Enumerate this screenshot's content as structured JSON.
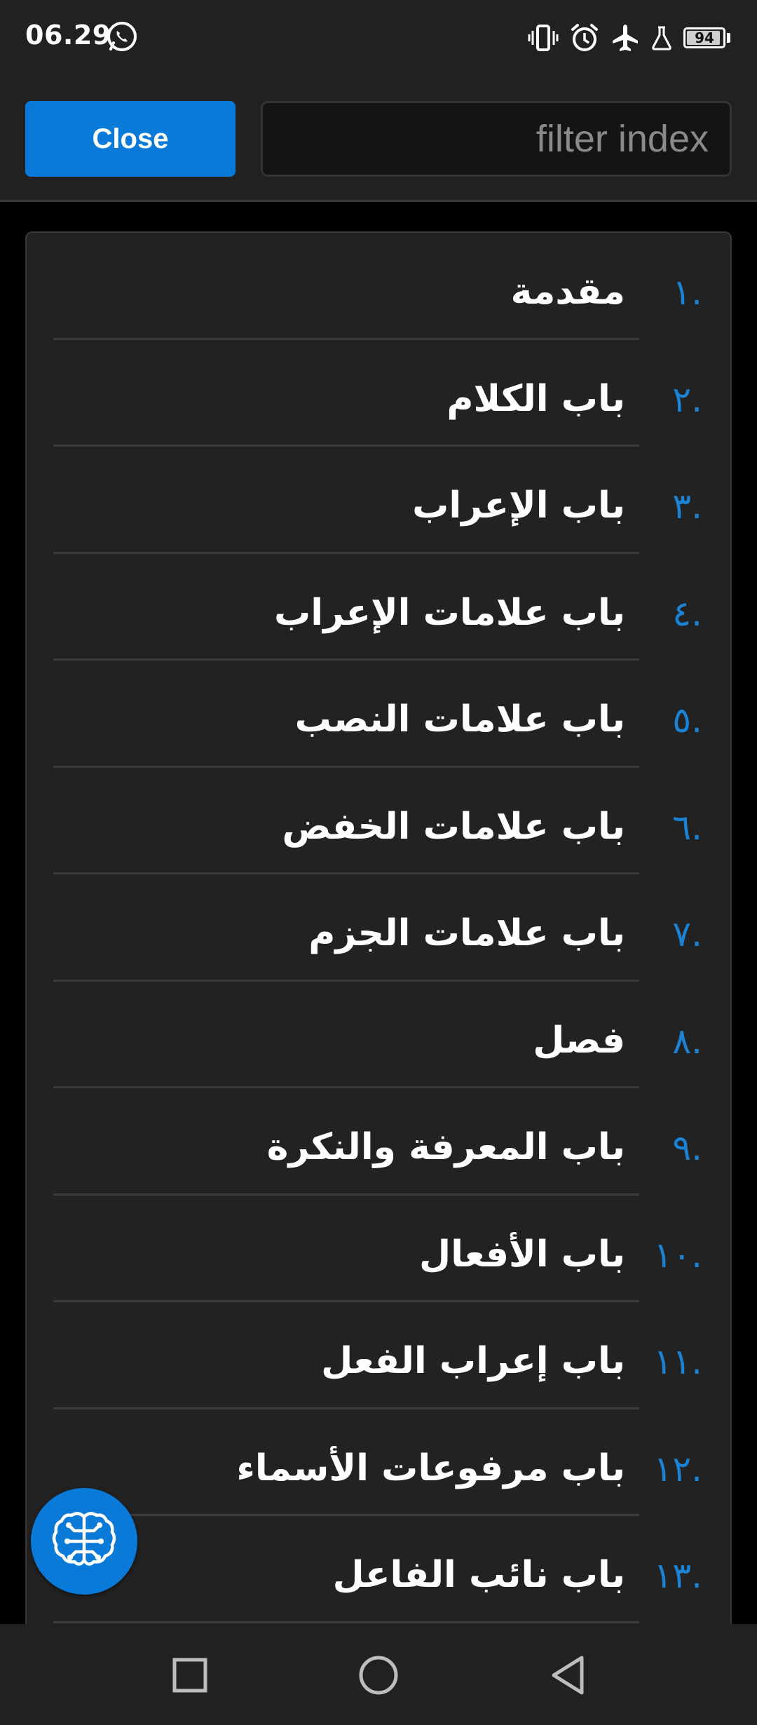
{
  "status_bar": {
    "time": "06.29",
    "battery_level": 94,
    "icons": [
      "whatsapp-icon",
      "vibrate-icon",
      "alarm-icon",
      "airplane-icon",
      "lab-flask-icon",
      "battery-icon"
    ]
  },
  "toolbar": {
    "close_label": "Close",
    "filter_placeholder": "filter index",
    "filter_value": ""
  },
  "index": {
    "items": [
      {
        "num": ".١",
        "label": "مقدمة"
      },
      {
        "num": ".٢",
        "label": "باب الكلام"
      },
      {
        "num": ".٣",
        "label": "باب الإعراب"
      },
      {
        "num": ".٤",
        "label": "باب علامات الإعراب"
      },
      {
        "num": ".٥",
        "label": "باب علامات النصب"
      },
      {
        "num": ".٦",
        "label": "باب علامات الخفض"
      },
      {
        "num": ".٧",
        "label": "باب علامات الجزم"
      },
      {
        "num": ".٨",
        "label": "فصل"
      },
      {
        "num": ".٩",
        "label": "باب المعرفة والنكرة"
      },
      {
        "num": ".١٠",
        "label": "باب الأفعال"
      },
      {
        "num": ".١١",
        "label": "باب إعراب الفعل"
      },
      {
        "num": ".١٢",
        "label": "باب مرفوعات الأسماء"
      },
      {
        "num": ".١٣",
        "label": "باب نائب الفاعل"
      }
    ]
  },
  "fab": {
    "icon": "brain-circuit-icon"
  },
  "nav": {
    "buttons": [
      "recent-apps-square-icon",
      "home-circle-icon",
      "back-triangle-icon"
    ]
  },
  "colors": {
    "accent": "#0a7ad9",
    "number": "#1a83d6",
    "background": "#212121"
  }
}
